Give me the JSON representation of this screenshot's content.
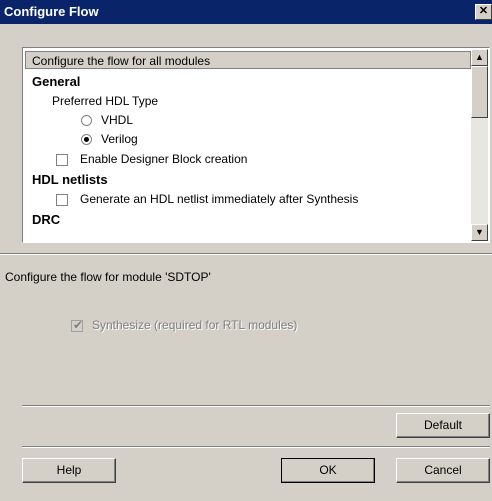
{
  "window": {
    "title": "Configure Flow",
    "close_glyph": "✕"
  },
  "all_modules": {
    "header": "Configure the flow for all modules",
    "general": {
      "heading": "General",
      "hdl_type_label": "Preferred HDL Type",
      "options": [
        {
          "label": "VHDL",
          "selected": false
        },
        {
          "label": "Verilog",
          "selected": true
        }
      ],
      "designer_block": {
        "label": "Enable Designer Block creation",
        "checked": false
      }
    },
    "hdl_netlists": {
      "heading": "HDL netlists",
      "generate": {
        "label": "Generate an HDL netlist immediately after Synthesis",
        "checked": false
      }
    },
    "drc": {
      "heading": "DRC"
    }
  },
  "module": {
    "label": "Configure the flow for module 'SDTOP'",
    "synthesize": {
      "label": "Synthesize (required for RTL modules)",
      "checked": true,
      "enabled": false
    }
  },
  "buttons": {
    "default": "Default",
    "help": "Help",
    "ok": "OK",
    "cancel": "Cancel"
  },
  "scrollbar": {
    "up_glyph": "▲",
    "down_glyph": "▼"
  }
}
